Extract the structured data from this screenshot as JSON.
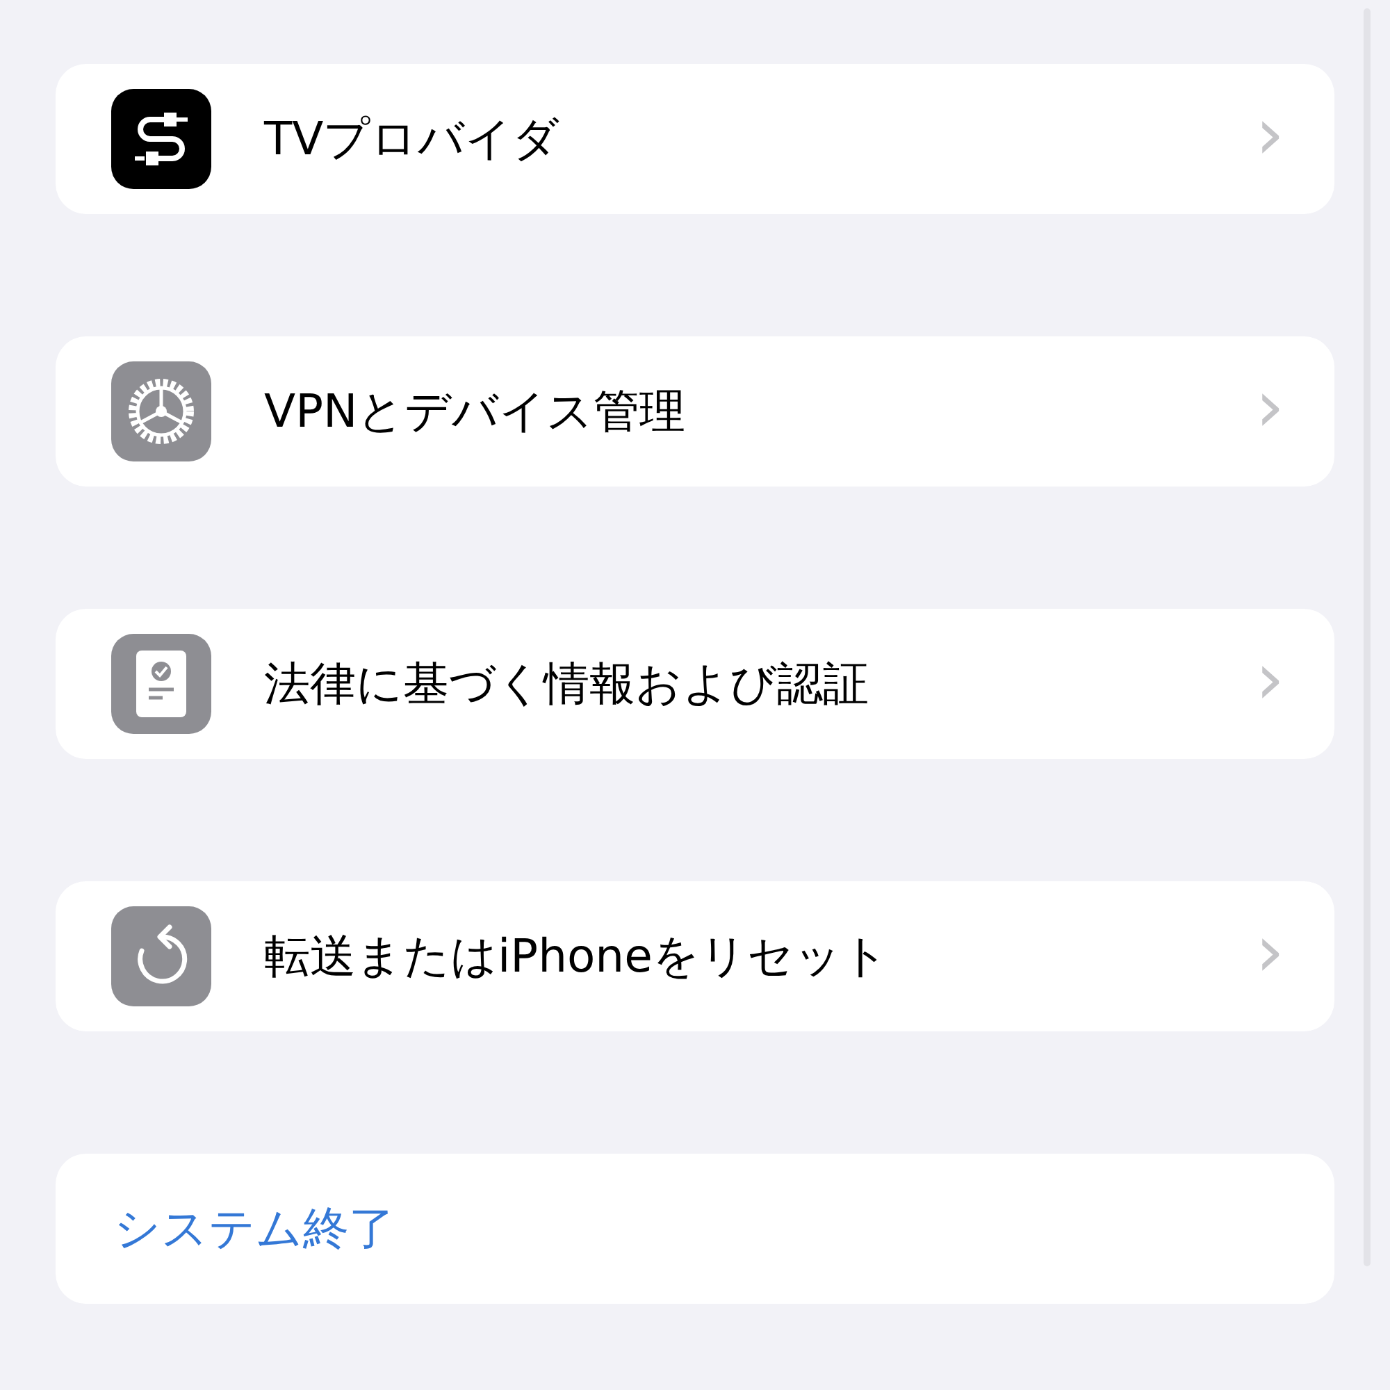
{
  "groups": [
    {
      "kind": "link",
      "label": "TVプロバイダ",
      "chevron": "›"
    },
    {
      "kind": "link",
      "label": "VPNとデバイス管理",
      "chevron": "›"
    },
    {
      "kind": "link",
      "label": "法律に基づく情報および認証",
      "chevron": "›"
    },
    {
      "kind": "link",
      "label": "転送またはiPhoneをリセット",
      "chevron": "›"
    },
    {
      "kind": "action",
      "label": "システム終了"
    }
  ]
}
